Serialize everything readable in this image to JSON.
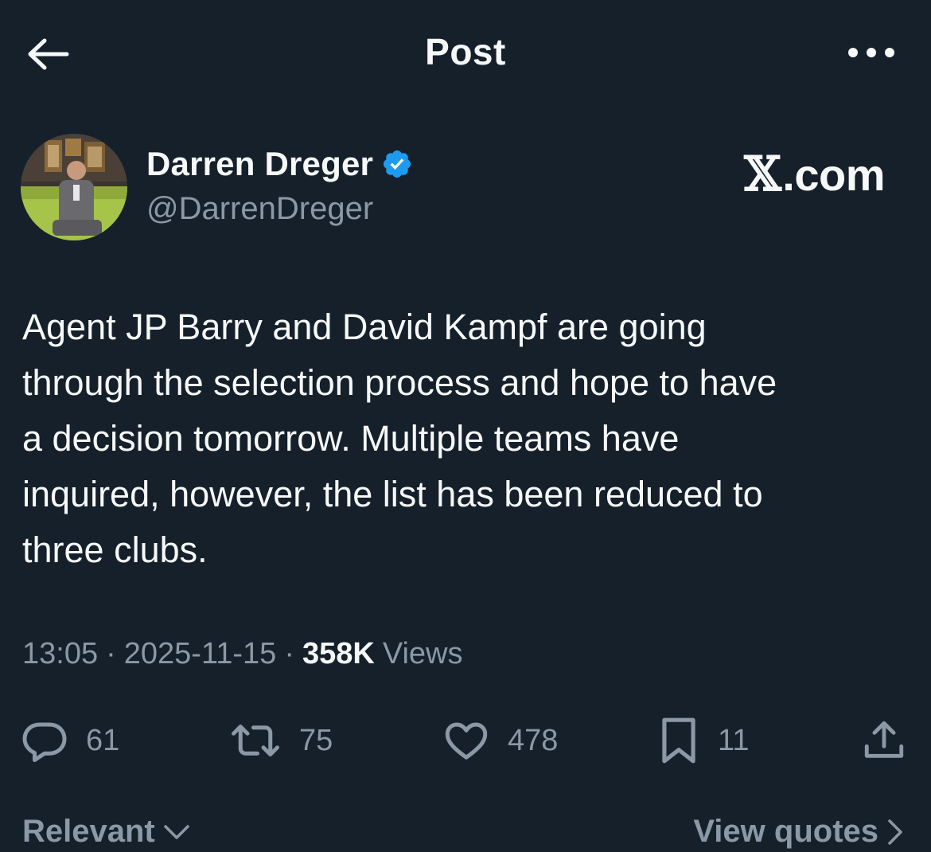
{
  "header": {
    "title": "Post",
    "back_icon": "arrow-left-icon",
    "more_icon": "more-horizontal-icon"
  },
  "author": {
    "display_name": "Darren Dreger",
    "handle": "@DarrenDreger",
    "verified": true,
    "verified_color": "#1d9bf0",
    "avatar_icon": "avatar-photo"
  },
  "watermark": {
    "glyph": "𝕏",
    "text": ".com"
  },
  "post": {
    "text": "Agent JP Barry and David Kampf are going\nthrough the selection process and hope to have\na decision tomorrow. Multiple teams have\ninquired, however, the list has been reduced to\nthree clubs."
  },
  "meta": {
    "time": "13:05",
    "separator": "·",
    "date": "2025-11-15",
    "views_count": "358K",
    "views_label": "Views"
  },
  "actions": {
    "replies": "61",
    "reposts": "75",
    "likes": "478",
    "bookmarks": "11",
    "icons": [
      "reply-icon",
      "repost-icon",
      "like-icon",
      "bookmark-icon",
      "share-icon"
    ]
  },
  "bottom": {
    "sort_label": "Relevant",
    "quotes_label": "View quotes"
  },
  "colors": {
    "background": "#15202b",
    "text": "#f7f9f9",
    "muted": "#8b98a5",
    "accent": "#1d9bf0"
  }
}
